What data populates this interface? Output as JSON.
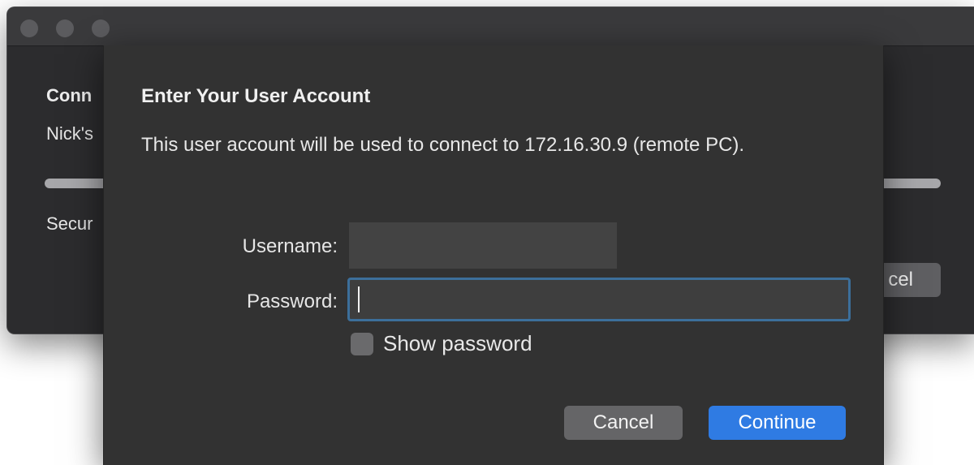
{
  "background_window": {
    "heading": "Conn",
    "subtitle": "Nick's",
    "status": "Secur",
    "cancel_label": "cel"
  },
  "dialog": {
    "title": "Enter Your User Account",
    "message": "This user account will be used to connect to 172.16.30.9 (remote PC).",
    "username": {
      "label": "Username:",
      "value": ""
    },
    "password": {
      "label": "Password:",
      "value": ""
    },
    "show_password": {
      "label": "Show password",
      "checked": false
    },
    "buttons": {
      "cancel": "Cancel",
      "continue": "Continue"
    }
  },
  "colors": {
    "accent": "#2f7be3",
    "focus_ring": "#3c6f9b",
    "sheet_background": "#323232",
    "window_background": "#2c2c2e"
  }
}
